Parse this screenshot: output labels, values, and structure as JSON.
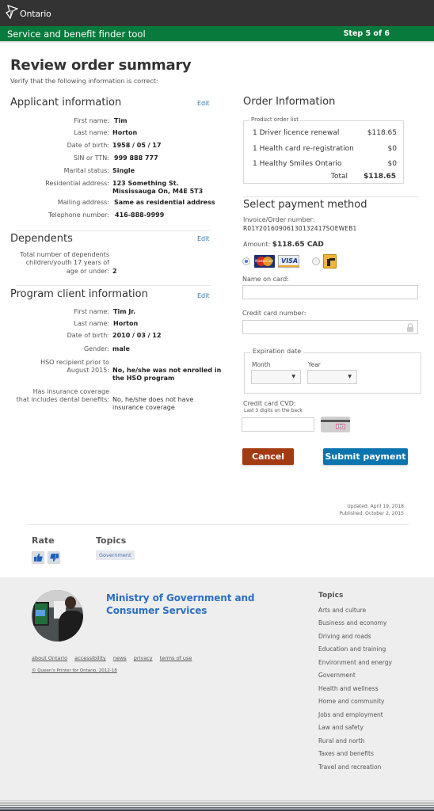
{
  "header": {
    "brand": "Ontario",
    "tool_title": "Service and benefit finder tool",
    "step": "Step 5 of 6"
  },
  "page": {
    "title": "Review order summary",
    "subtitle": "Verify that the following information is correct:"
  },
  "applicant": {
    "title": "Applicant information",
    "edit": "Edit",
    "fields": [
      {
        "label": "First name:",
        "value": "Tim"
      },
      {
        "label": "Last name:",
        "value": "Horton"
      },
      {
        "label": "Date of birth:",
        "value": "1958 / 05 / 17"
      },
      {
        "label": "SIN or TTN:",
        "value": "999 888 777"
      },
      {
        "label": "Marital status:",
        "value": "Single"
      },
      {
        "label": "Residential address:",
        "value": "123 Something St.",
        "value2": "Mississauga On, M4E 5T3"
      },
      {
        "label": "Mailing address:",
        "value": "Same as residential address"
      },
      {
        "label": "Telephone number:",
        "value": "416-888-9999"
      }
    ]
  },
  "dependents": {
    "title": "Dependents",
    "edit": "Edit",
    "label_line1": "Total number of dependents",
    "label_line2": "children/youth 17 years of",
    "label_line3": "age or under:",
    "value": "2"
  },
  "program_client": {
    "title": "Program client information",
    "edit": "Edit",
    "fields": [
      {
        "label": "First name:",
        "value": "Tim Jr."
      },
      {
        "label": "Last name:",
        "value": "Horton"
      },
      {
        "label": "Date of birth:",
        "value": "2010 / 03 / 12"
      },
      {
        "label": "Gender:",
        "value": "male"
      },
      {
        "label": "HSO recipient prior to",
        "label2": "August 2015:",
        "value": "No, he/she was not enrolled in",
        "value2": "the HSO program"
      },
      {
        "label": "Has insurance coverage",
        "label2": "that includes dental benefits:",
        "value": "No, he/she does not have",
        "value2": "insurance coverage"
      }
    ]
  },
  "order": {
    "title": "Order Information",
    "list_legend": "Product order list",
    "items": [
      {
        "name": "1 Driver licence renewal",
        "price": "$118.65"
      },
      {
        "name": "1 Health card re-registration",
        "price": "$0"
      },
      {
        "name": "1 Healthy Smiles Ontario",
        "price": "$0"
      }
    ],
    "total_label": "Total",
    "total": "$118.65"
  },
  "payment": {
    "title": "Select payment method",
    "invoice_label": "Invoice/Order number:",
    "invoice_value": "R01Y20160906130132417SOEWEB1",
    "amount_label": "Amount:",
    "amount_value": "$118.65 CAD",
    "options": [
      {
        "name": "MasterCard / VISA",
        "selected": true
      },
      {
        "name": "Interac",
        "selected": false
      }
    ],
    "mastercard_text": "MasterCard",
    "visa_text": "VISA",
    "name_label": "Name on card:",
    "name_value": "",
    "card_label": "Credit card number:",
    "card_value": "",
    "expiration_legend": "Expiration date",
    "month_label": "Month",
    "month_value": "",
    "year_label": "Year",
    "year_value": "",
    "cvd_label": "Credit card CVD:",
    "cvd_hint": "Last 3 digits on the back",
    "cvd_value": "",
    "cvd_sample": "123",
    "cancel": "Cancel",
    "submit": "Submit payment"
  },
  "meta": {
    "updated": "Updated: April 19, 2018",
    "published": "Published: October 2, 2015"
  },
  "rate": {
    "title": "Rate"
  },
  "topics": {
    "title": "Topics",
    "tag": "Government"
  },
  "footer": {
    "ministry_line1": "Ministry of Government and",
    "ministry_line2": "Consumer Services",
    "links": [
      "about Ontario",
      "accessibility",
      "news",
      "privacy",
      "terms of use"
    ],
    "copyright": "© Queen's Printer for Ontario, 2012-18",
    "topics_title": "Topics",
    "topics": [
      "Arts and culture",
      "Business and economy",
      "Driving and roads",
      "Education and training",
      "Environment and energy",
      "Government",
      "Health and wellness",
      "Home and community",
      "Jobs and employment",
      "Law and safety",
      "Rural and north",
      "Taxes and benefits",
      "Travel and recreation"
    ]
  },
  "colors": {
    "header_bg": "#333333",
    "green_bar": "#077a3c",
    "link": "#2a7ab8",
    "cancel": "#a33a12",
    "submit": "#0a74ae",
    "footer_bg": "#eeeeee",
    "ministry": "#2c6fc2"
  }
}
